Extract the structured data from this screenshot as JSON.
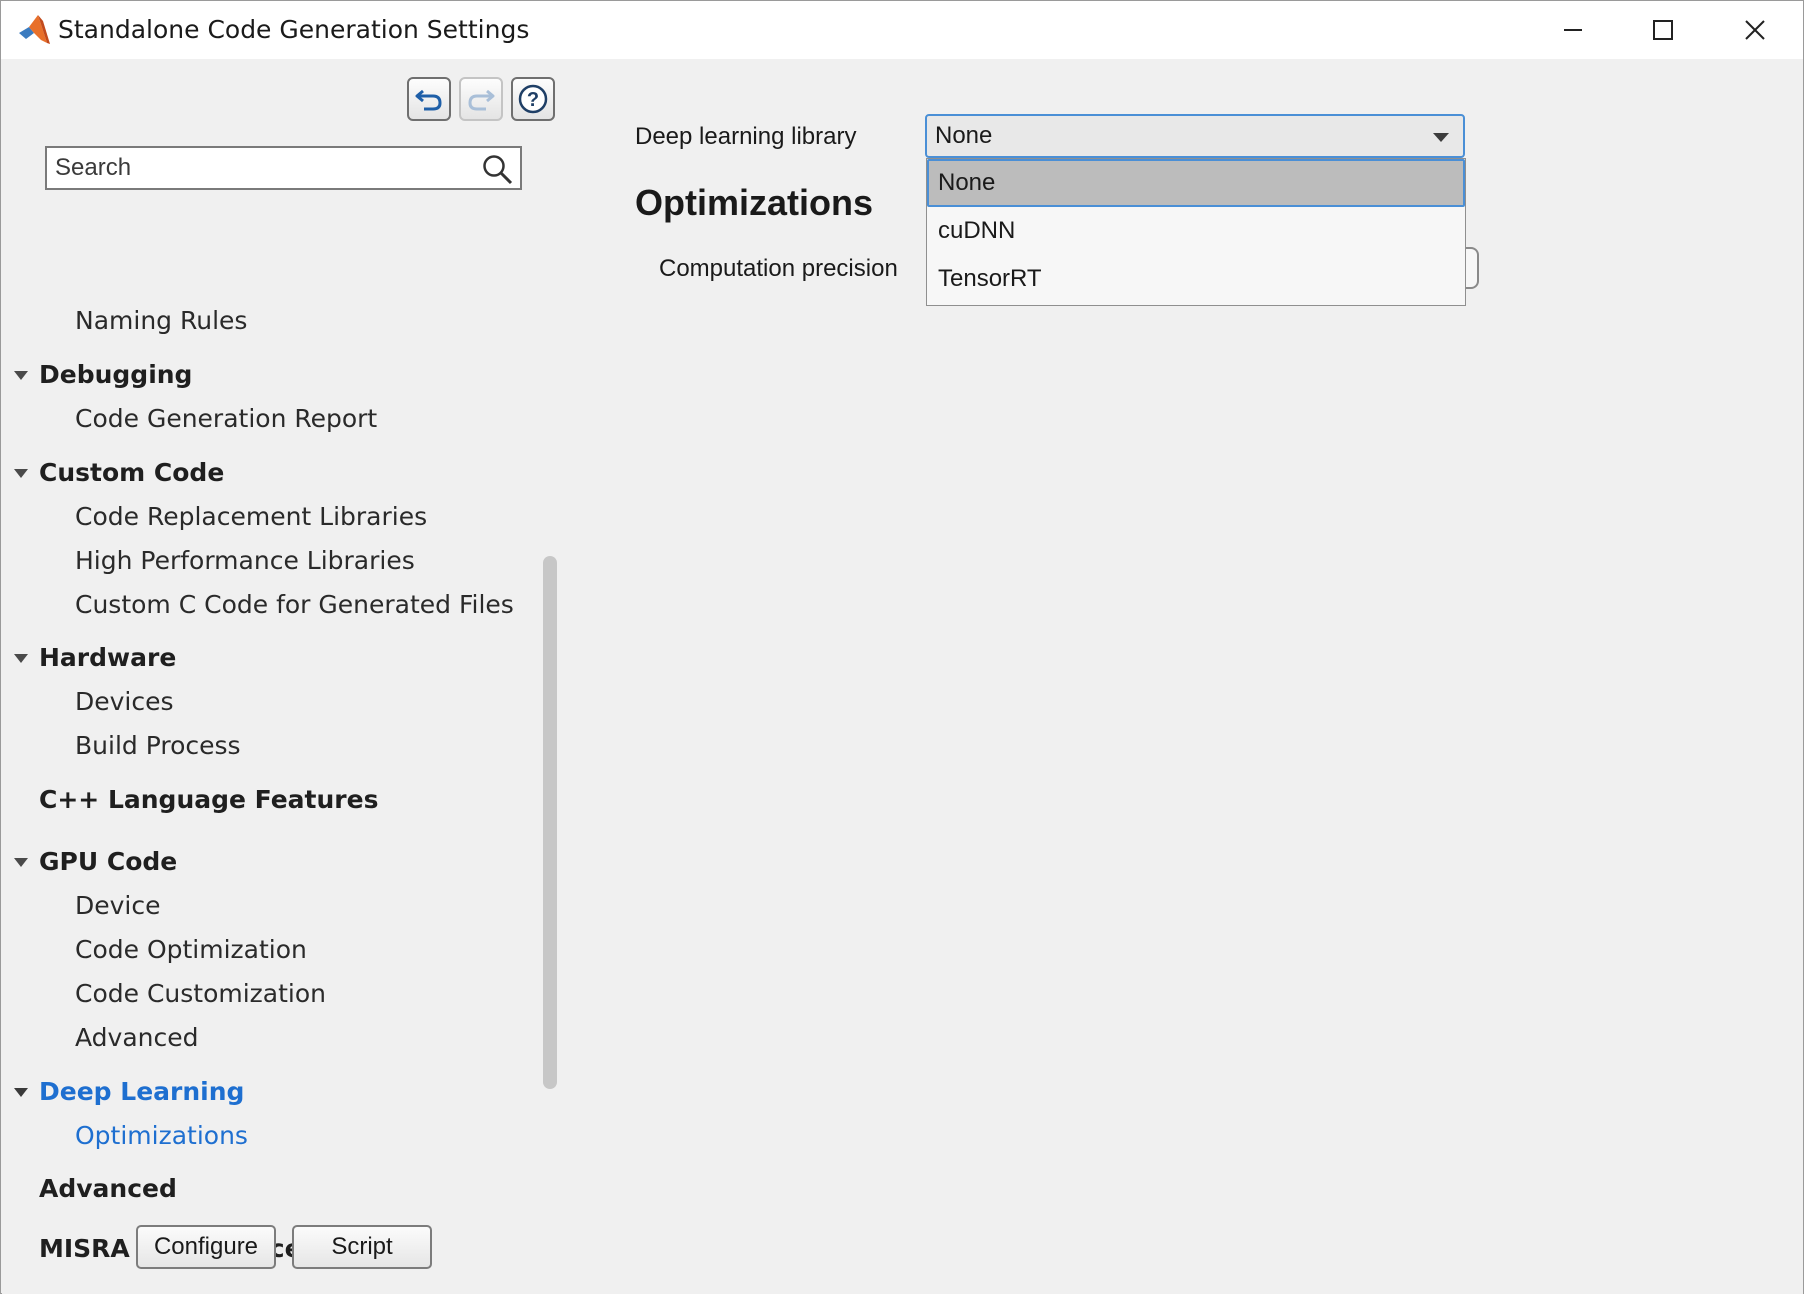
{
  "window": {
    "title": "Standalone Code Generation Settings"
  },
  "toolbar": {
    "undo_icon": "undo-icon",
    "redo_icon": "redo-icon",
    "help_icon": "help-icon"
  },
  "search": {
    "placeholder": "Search",
    "value": ""
  },
  "tree": {
    "items": [
      {
        "label": "Naming Rules"
      },
      {
        "label": "Debugging"
      },
      {
        "label": "Code Generation Report"
      },
      {
        "label": "Custom Code"
      },
      {
        "label": "Code Replacement Libraries"
      },
      {
        "label": "High Performance Libraries"
      },
      {
        "label": "Custom C Code for Generated Files"
      },
      {
        "label": "Hardware"
      },
      {
        "label": "Devices"
      },
      {
        "label": "Build Process"
      },
      {
        "label": "C++ Language Features"
      },
      {
        "label": "GPU Code"
      },
      {
        "label": "Device"
      },
      {
        "label": "Code Optimization"
      },
      {
        "label": "Code Customization"
      },
      {
        "label": "Advanced"
      },
      {
        "label": "Deep Learning"
      },
      {
        "label": "Optimizations"
      },
      {
        "label": "Advanced"
      },
      {
        "label": "MISRA Compliance"
      }
    ]
  },
  "buttons": {
    "configure": "Configure",
    "script": "Script"
  },
  "main": {
    "deep_learning_library_label": "Deep learning library",
    "deep_learning_library_value": "None",
    "section_title": "Optimizations",
    "computation_precision_label": "Computation precision",
    "dropdown_options": [
      "None",
      "cuDNN",
      "TensorRT"
    ]
  },
  "colors": {
    "accent": "#1e6fd0",
    "focus_border": "#4a8fd6",
    "background": "#f0f0f0"
  }
}
